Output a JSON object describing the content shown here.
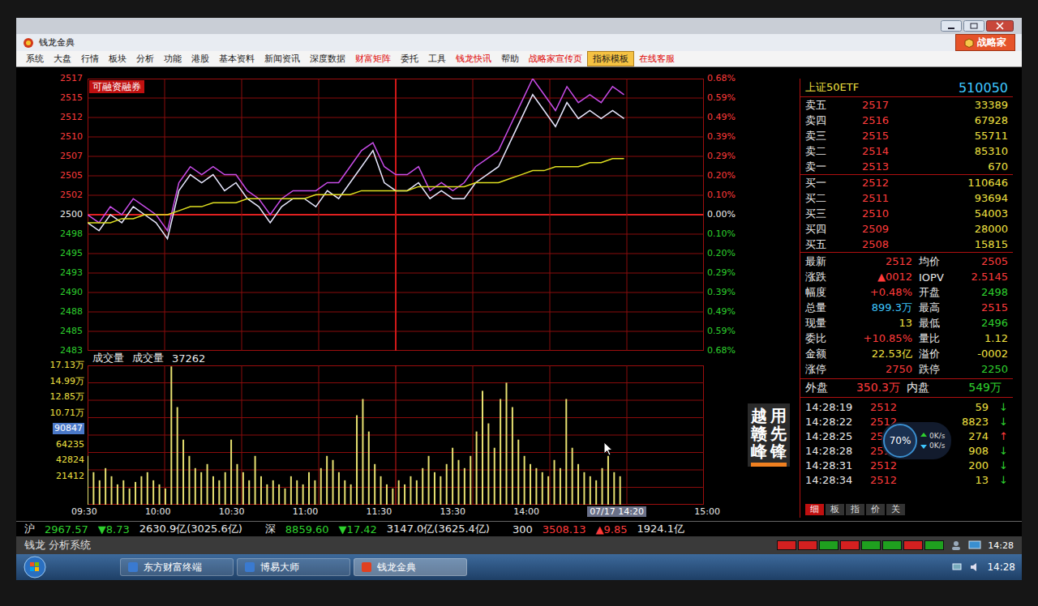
{
  "window": {
    "title": "钱龙金典",
    "brand_button": "战略家"
  },
  "menu": [
    {
      "label": "系统",
      "color": "#1a1a1a",
      "highlight": false
    },
    {
      "label": "大盘",
      "color": "#1a1a1a",
      "highlight": false
    },
    {
      "label": "行情",
      "color": "#1a1a1a",
      "highlight": false
    },
    {
      "label": "板块",
      "color": "#1a1a1a",
      "highlight": false
    },
    {
      "label": "分析",
      "color": "#1a1a1a",
      "highlight": false
    },
    {
      "label": "功能",
      "color": "#1a1a1a",
      "highlight": false
    },
    {
      "label": "港股",
      "color": "#1a1a1a",
      "highlight": false
    },
    {
      "label": "基本资料",
      "color": "#1a1a1a",
      "highlight": false
    },
    {
      "label": "新闻资讯",
      "color": "#1a1a1a",
      "highlight": false
    },
    {
      "label": "深度数据",
      "color": "#1a1a1a",
      "highlight": false
    },
    {
      "label": "财富矩阵",
      "color": "#e00000",
      "highlight": false
    },
    {
      "label": "委托",
      "color": "#1a1a1a",
      "highlight": false
    },
    {
      "label": "工具",
      "color": "#1a1a1a",
      "highlight": false
    },
    {
      "label": "钱龙快讯",
      "color": "#e00000",
      "highlight": false
    },
    {
      "label": "帮助",
      "color": "#1a1a1a",
      "highlight": false
    },
    {
      "label": "战略家宣传页",
      "color": "#e00000",
      "highlight": false
    },
    {
      "label": "指标模板",
      "color": "#1a1a1a",
      "highlight": true
    },
    {
      "label": "在线客服",
      "color": "#e00000",
      "highlight": false
    }
  ],
  "chart": {
    "badge": "可融资融券",
    "price_axis": [
      {
        "label": "2517",
        "color": "#ff3b3b"
      },
      {
        "label": "2515",
        "color": "#ff3b3b"
      },
      {
        "label": "2512",
        "color": "#ff3b3b"
      },
      {
        "label": "2510",
        "color": "#ff3b3b"
      },
      {
        "label": "2507",
        "color": "#ff3b3b"
      },
      {
        "label": "2505",
        "color": "#ff3b3b"
      },
      {
        "label": "2502",
        "color": "#ff3b3b"
      },
      {
        "label": "2500",
        "color": "#f0f0f0"
      },
      {
        "label": "2498",
        "color": "#2ed02e"
      },
      {
        "label": "2495",
        "color": "#2ed02e"
      },
      {
        "label": "2493",
        "color": "#2ed02e"
      },
      {
        "label": "2490",
        "color": "#2ed02e"
      },
      {
        "label": "2488",
        "color": "#2ed02e"
      },
      {
        "label": "2485",
        "color": "#2ed02e"
      },
      {
        "label": "2483",
        "color": "#2ed02e"
      }
    ],
    "percent_axis": [
      {
        "label": "0.68%",
        "color": "#ff3b3b"
      },
      {
        "label": "0.59%",
        "color": "#ff3b3b"
      },
      {
        "label": "0.49%",
        "color": "#ff3b3b"
      },
      {
        "label": "0.39%",
        "color": "#ff3b3b"
      },
      {
        "label": "0.29%",
        "color": "#ff3b3b"
      },
      {
        "label": "0.20%",
        "color": "#ff3b3b"
      },
      {
        "label": "0.10%",
        "color": "#ff3b3b"
      },
      {
        "label": "0.00%",
        "color": "#f0f0f0"
      },
      {
        "label": "0.10%",
        "color": "#2ed02e"
      },
      {
        "label": "0.20%",
        "color": "#2ed02e"
      },
      {
        "label": "0.29%",
        "color": "#2ed02e"
      },
      {
        "label": "0.39%",
        "color": "#2ed02e"
      },
      {
        "label": "0.49%",
        "color": "#2ed02e"
      },
      {
        "label": "0.59%",
        "color": "#2ed02e"
      },
      {
        "label": "0.68%",
        "color": "#2ed02e"
      }
    ],
    "session_slots": 55,
    "series": [
      {
        "color": "#c84ce8",
        "values": [
          2500,
          2499,
          2501,
          2500,
          2502,
          2501,
          2500,
          2498,
          2504,
          2506,
          2505,
          2506,
          2505,
          2505,
          2503,
          2502,
          2500,
          2502,
          2503,
          2503,
          2503,
          2504,
          2504,
          2506,
          2508,
          2509,
          2506,
          2505,
          2505,
          2506,
          2503,
          2504,
          2503,
          2504,
          2506,
          2507,
          2508,
          2511,
          2514,
          2517,
          2515,
          2513,
          2516,
          2514,
          2515,
          2514,
          2516,
          2515
        ]
      },
      {
        "color": "#e8e8ff",
        "values": [
          2499,
          2498,
          2500,
          2499,
          2501,
          2500,
          2499,
          2497,
          2503,
          2505,
          2504,
          2505,
          2503,
          2504,
          2502,
          2501,
          2499,
          2501,
          2502,
          2502,
          2501,
          2503,
          2502,
          2504,
          2506,
          2508,
          2504,
          2503,
          2503,
          2504,
          2502,
          2503,
          2502,
          2502,
          2504,
          2505,
          2506,
          2509,
          2512,
          2515,
          2513,
          2511,
          2514,
          2512,
          2513,
          2512,
          2513,
          2512
        ]
      },
      {
        "color": "#e0e020",
        "values": [
          2499,
          2499,
          2499,
          2499.5,
          2499.5,
          2500,
          2500,
          2500,
          2500.5,
          2501,
          2501,
          2501.5,
          2501.5,
          2501.5,
          2502,
          2502,
          2502,
          2502,
          2502,
          2502,
          2502.5,
          2502.5,
          2502.5,
          2502.5,
          2503,
          2503,
          2503,
          2503,
          2503,
          2503.5,
          2503.5,
          2503.5,
          2503.5,
          2503.5,
          2504,
          2504,
          2504,
          2504.5,
          2505,
          2505.5,
          2505.5,
          2506,
          2506,
          2506,
          2506.5,
          2506.5,
          2507,
          2507
        ]
      }
    ]
  },
  "volume": {
    "title": "成交量",
    "reading_label": "成交量",
    "reading": "37262",
    "axis": [
      {
        "label": "17.13万",
        "cursor": false
      },
      {
        "label": "14.99万",
        "cursor": false
      },
      {
        "label": "12.85万",
        "cursor": false
      },
      {
        "label": "10.71万",
        "cursor": false
      },
      {
        "label": "90847",
        "cursor": true
      },
      {
        "label": "64235",
        "cursor": false
      },
      {
        "label": "42824",
        "cursor": false
      },
      {
        "label": "21412",
        "cursor": false
      }
    ],
    "session_slots": 104,
    "values": [
      60000,
      40000,
      30000,
      45000,
      35000,
      25000,
      30000,
      20000,
      28000,
      35000,
      40000,
      30000,
      25000,
      20000,
      170000,
      120000,
      80000,
      60000,
      45000,
      40000,
      50000,
      35000,
      30000,
      40000,
      80000,
      50000,
      40000,
      30000,
      60000,
      35000,
      25000,
      30000,
      25000,
      20000,
      35000,
      30000,
      25000,
      40000,
      30000,
      45000,
      60000,
      55000,
      40000,
      30000,
      25000,
      110000,
      130000,
      90000,
      50000,
      35000,
      25000,
      20000,
      30000,
      25000,
      35000,
      30000,
      45000,
      60000,
      40000,
      35000,
      50000,
      70000,
      55000,
      45000,
      60000,
      90000,
      140000,
      100000,
      70000,
      130000,
      150000,
      120000,
      80000,
      60000,
      50000,
      45000,
      40000,
      35000,
      55000,
      45000,
      130000,
      70000,
      50000,
      40000,
      35000,
      30000,
      45000,
      60000,
      40000,
      35000
    ]
  },
  "time_axis": [
    {
      "label": "09:30",
      "cursor": false
    },
    {
      "label": "10:00",
      "cursor": false
    },
    {
      "label": "10:30",
      "cursor": false
    },
    {
      "label": "11:00",
      "cursor": false
    },
    {
      "label": "11:30",
      "cursor": false
    },
    {
      "label": "13:30",
      "cursor": false
    },
    {
      "label": "14:00",
      "cursor": false
    },
    {
      "label": "07/17 14:20",
      "cursor": true
    },
    {
      "label": "15:00",
      "cursor": false
    }
  ],
  "ad": {
    "columns": [
      "越赣峰",
      "用先锋"
    ]
  },
  "quote": {
    "name": "上证50ETF",
    "code": "510050",
    "book": [
      {
        "label": "卖五",
        "price": "2517",
        "volume": "33389"
      },
      {
        "label": "卖四",
        "price": "2516",
        "volume": "67928"
      },
      {
        "label": "卖三",
        "price": "2515",
        "volume": "55711"
      },
      {
        "label": "卖二",
        "price": "2514",
        "volume": "85310"
      },
      {
        "label": "卖一",
        "price": "2513",
        "volume": "670"
      },
      {
        "label": "买一",
        "price": "2512",
        "volume": "110646"
      },
      {
        "label": "买二",
        "price": "2511",
        "volume": "93694"
      },
      {
        "label": "买三",
        "price": "2510",
        "volume": "54003"
      },
      {
        "label": "买四",
        "price": "2509",
        "volume": "28000"
      },
      {
        "label": "买五",
        "price": "2508",
        "volume": "15815"
      }
    ],
    "stats": [
      {
        "label": "最新",
        "value": "2512",
        "color": "#ff3b3b"
      },
      {
        "label": "均价",
        "value": "2505",
        "color": "#ff3b3b"
      },
      {
        "label": "涨跌",
        "value": "▲0012",
        "color": "#ff3b3b"
      },
      {
        "label": "IOPV",
        "value": "2.5145",
        "color": "#ff3b3b"
      },
      {
        "label": "幅度",
        "value": "+0.48%",
        "color": "#ff3b3b"
      },
      {
        "label": "开盘",
        "value": "2498",
        "color": "#2ed02e"
      },
      {
        "label": "总量",
        "value": "899.3万",
        "color": "#3ec8ff"
      },
      {
        "label": "最高",
        "value": "2515",
        "color": "#ff3b3b"
      },
      {
        "label": "现量",
        "value": "13",
        "color": "#f0e040"
      },
      {
        "label": "最低",
        "value": "2496",
        "color": "#2ed02e"
      },
      {
        "label": "委比",
        "value": "+10.85%",
        "color": "#ff3b3b"
      },
      {
        "label": "量比",
        "value": "1.12",
        "color": "#f0e040"
      },
      {
        "label": "金额",
        "value": "22.53亿",
        "color": "#f0e040"
      },
      {
        "label": "溢价",
        "value": "-0002",
        "color": "#f0e040"
      },
      {
        "label": "涨停",
        "value": "2750",
        "color": "#ff3b3b"
      },
      {
        "label": "跌停",
        "value": "2250",
        "color": "#2ed02e"
      }
    ],
    "flow": [
      {
        "label": "外盘",
        "value": "350.3万",
        "color": "#ff3b3b"
      },
      {
        "label": "内盘",
        "value": "549万",
        "color": "#2ed02e"
      }
    ],
    "ticks": [
      {
        "time": "14:28:19",
        "price": "2512",
        "volume": "59",
        "arrow": "↓",
        "color": "#2ed02e"
      },
      {
        "time": "14:28:22",
        "price": "2512",
        "volume": "8823",
        "arrow": "↓",
        "color": "#2ed02e"
      },
      {
        "time": "14:28:25",
        "price": "2513",
        "volume": "274",
        "arrow": "↑",
        "color": "#ff3b3b"
      },
      {
        "time": "14:28:28",
        "price": "2512",
        "volume": "908",
        "arrow": "↓",
        "color": "#2ed02e"
      },
      {
        "time": "14:28:31",
        "price": "2512",
        "volume": "200",
        "arrow": "↓",
        "color": "#2ed02e"
      },
      {
        "time": "14:28:34",
        "price": "2512",
        "volume": "13",
        "arrow": "↓",
        "color": "#2ed02e"
      }
    ],
    "tabs": [
      {
        "label": "细",
        "selected": true
      },
      {
        "label": "板",
        "selected": false
      },
      {
        "label": "指",
        "selected": false
      },
      {
        "label": "价",
        "selected": false
      },
      {
        "label": "关",
        "selected": false
      }
    ]
  },
  "net_widget": {
    "percent": "70%",
    "up": "0K/s",
    "down": "0K/s"
  },
  "index_bar": [
    {
      "name": "沪",
      "value": "2967.57",
      "change": "▼8.73",
      "amount": "2630.9亿(3025.6亿)",
      "color": "#2ed02e"
    },
    {
      "name": "深",
      "value": "8859.60",
      "change": "▼17.42",
      "amount": "3147.0亿(3625.4亿)",
      "color": "#2ed02e"
    },
    {
      "name": "300",
      "value": "3508.13",
      "change": "▲9.85",
      "amount": "1924.1亿",
      "color": "#ff3b3b"
    }
  ],
  "app_status": {
    "title": "钱龙 分析系统",
    "time": "14:28",
    "breadth": [
      {
        "color": "#d42020"
      },
      {
        "color": "#d42020"
      },
      {
        "color": "#1fa01f"
      },
      {
        "color": "#d42020"
      },
      {
        "color": "#1fa01f"
      },
      {
        "color": "#1fa01f"
      },
      {
        "color": "#d42020"
      },
      {
        "color": "#1fa01f"
      }
    ]
  },
  "taskbar": {
    "tasks": [
      {
        "label": "东方财富终端",
        "selected": false
      },
      {
        "label": "博易大师",
        "selected": false
      },
      {
        "label": "钱龙金典",
        "selected": true
      }
    ],
    "clock": "14:28"
  }
}
